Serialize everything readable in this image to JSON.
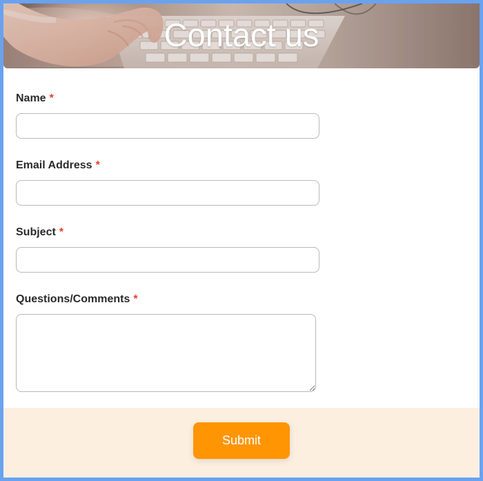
{
  "header": {
    "title": "Contact us"
  },
  "form": {
    "fields": [
      {
        "label": "Name",
        "required_mark": "*",
        "value": "",
        "placeholder": ""
      },
      {
        "label": "Email Address",
        "required_mark": "*",
        "value": "",
        "placeholder": ""
      },
      {
        "label": "Subject",
        "required_mark": "*",
        "value": "",
        "placeholder": ""
      },
      {
        "label": "Questions/Comments",
        "required_mark": "*",
        "value": "",
        "placeholder": ""
      }
    ],
    "submit_label": "Submit"
  },
  "icons": {
    "hero_image": "keyboard-typing-image",
    "resize_handle": "resize-grip-icon"
  },
  "colors": {
    "frame_border": "#69a2f0",
    "required": "#ea3b2f",
    "footer_bg": "#fcefe0",
    "button_bg": "#ff9502"
  }
}
